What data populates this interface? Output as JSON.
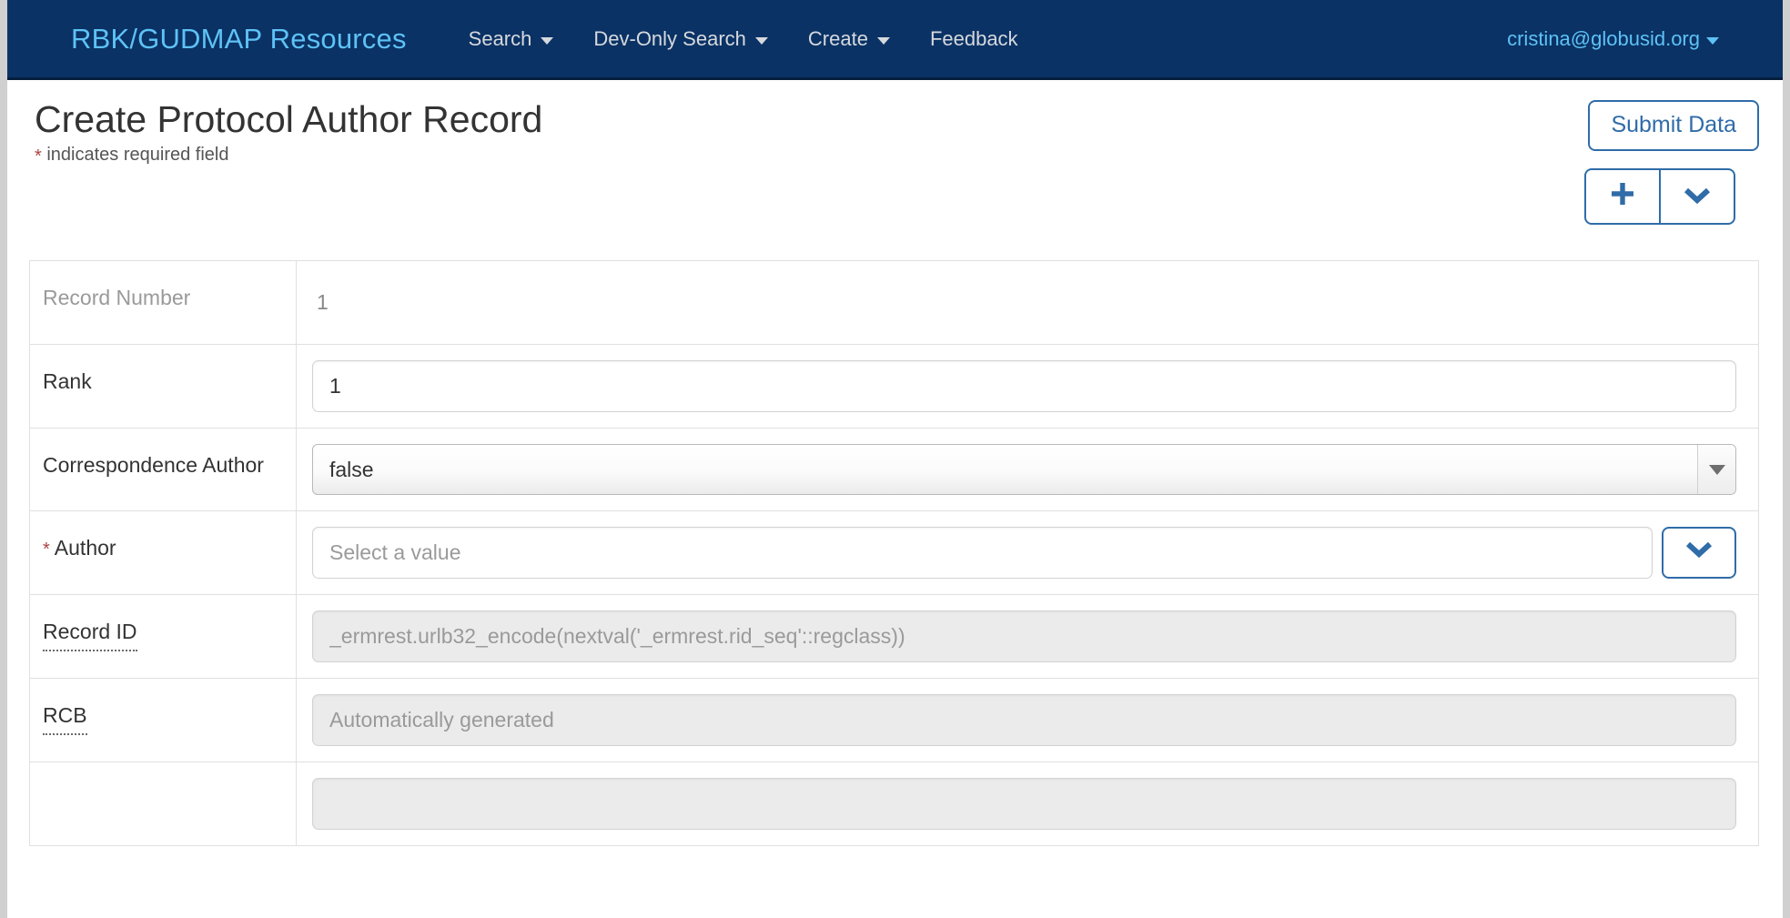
{
  "navbar": {
    "brand": "RBK/GUDMAP Resources",
    "items": [
      {
        "label": "Search",
        "has_caret": true,
        "icon": "chevron-down-icon"
      },
      {
        "label": "Dev-Only Search",
        "has_caret": true,
        "icon": "chevron-down-icon"
      },
      {
        "label": "Create",
        "has_caret": true,
        "icon": "chevron-down-icon"
      },
      {
        "label": "Feedback",
        "has_caret": false,
        "icon": ""
      }
    ],
    "user": "cristina@globusid.org",
    "user_caret_icon": "caret-down-icon",
    "bg_color": "#0a3265",
    "brand_color": "#5ec2f5",
    "link_color": "#d6d9dd"
  },
  "header": {
    "title": "Create Protocol Author Record",
    "required_star": "*",
    "required_note": "indicates required field",
    "required_star_color": "#a94442",
    "submit_label": "Submit Data",
    "add_icon": "plus-icon",
    "add_icon_glyph": "✚",
    "more_icon": "chevron-down-icon",
    "accent_color": "#2f6ca8"
  },
  "form": {
    "rows": [
      {
        "key": "Record Number",
        "key_muted": true,
        "required": false,
        "tooltip_underline": false,
        "control": "static",
        "value": "1"
      },
      {
        "key": "Rank",
        "key_muted": false,
        "required": false,
        "tooltip_underline": false,
        "control": "text",
        "value": "1",
        "placeholder": ""
      },
      {
        "key": "Correspondence Author",
        "key_muted": false,
        "required": false,
        "tooltip_underline": false,
        "control": "select",
        "value": "false",
        "options": [
          "false",
          "true"
        ]
      },
      {
        "key": "Author",
        "key_muted": false,
        "required": true,
        "tooltip_underline": false,
        "control": "combo",
        "value": "",
        "placeholder": "Select a value",
        "button_icon": "chevron-down-icon"
      },
      {
        "key": "Record ID",
        "key_muted": false,
        "required": false,
        "tooltip_underline": true,
        "control": "text-disabled",
        "value": "",
        "placeholder": "_ermrest.urlb32_encode(nextval('_ermrest.rid_seq'::regclass))"
      },
      {
        "key": "RCB",
        "key_muted": false,
        "required": false,
        "tooltip_underline": true,
        "control": "text-disabled",
        "value": "",
        "placeholder": "Automatically generated"
      },
      {
        "key": "",
        "key_muted": false,
        "required": false,
        "tooltip_underline": false,
        "control": "text-disabled",
        "value": "",
        "placeholder": ""
      }
    ]
  }
}
